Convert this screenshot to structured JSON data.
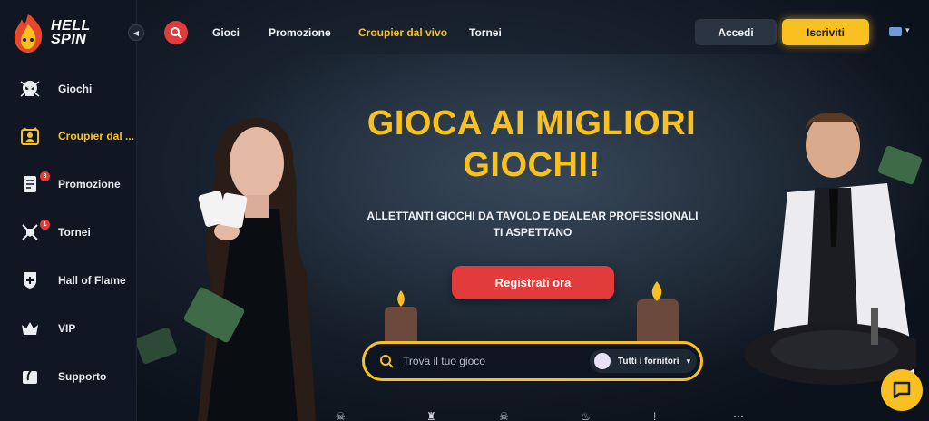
{
  "brand": {
    "name_line1": "HELL",
    "name_line2": "SPIN"
  },
  "sidebar": {
    "items": [
      {
        "label": "Giochi",
        "icon": "skull-icon",
        "active": false
      },
      {
        "label": "Croupier dal ...",
        "icon": "dealer-icon",
        "active": true
      },
      {
        "label": "Promozione",
        "icon": "scroll-icon",
        "badge": "3"
      },
      {
        "label": "Tornei",
        "icon": "swords-icon",
        "badge": "1"
      },
      {
        "label": "Hall of Flame",
        "icon": "shield-icon"
      },
      {
        "label": "VIP",
        "icon": "crown-icon"
      },
      {
        "label": "Supporto",
        "icon": "feather-icon"
      }
    ]
  },
  "nav": {
    "items": [
      "Gioci",
      "Promozione",
      "Croupier dal vivo",
      "Tornei"
    ],
    "active": "Croupier dal vivo"
  },
  "auth": {
    "login_label": "Accedi",
    "signup_label": "Iscriviti"
  },
  "hero": {
    "title_line1": "GIOCA AI MIGLIORI",
    "title_line2": "GIOCHI!",
    "subtitle": "ALLETTANTI GIOCHI DA TAVOLO E DEALEAR PROFESSIONALI TI ASPETTANO",
    "cta_label": "Registrati ora"
  },
  "search": {
    "placeholder": "Trova il tuo gioco",
    "providers_label": "Tutti i fornitori"
  },
  "colors": {
    "accent": "#f8c021",
    "cta": "#e23b3b",
    "sidebar_bg": "#101722"
  }
}
